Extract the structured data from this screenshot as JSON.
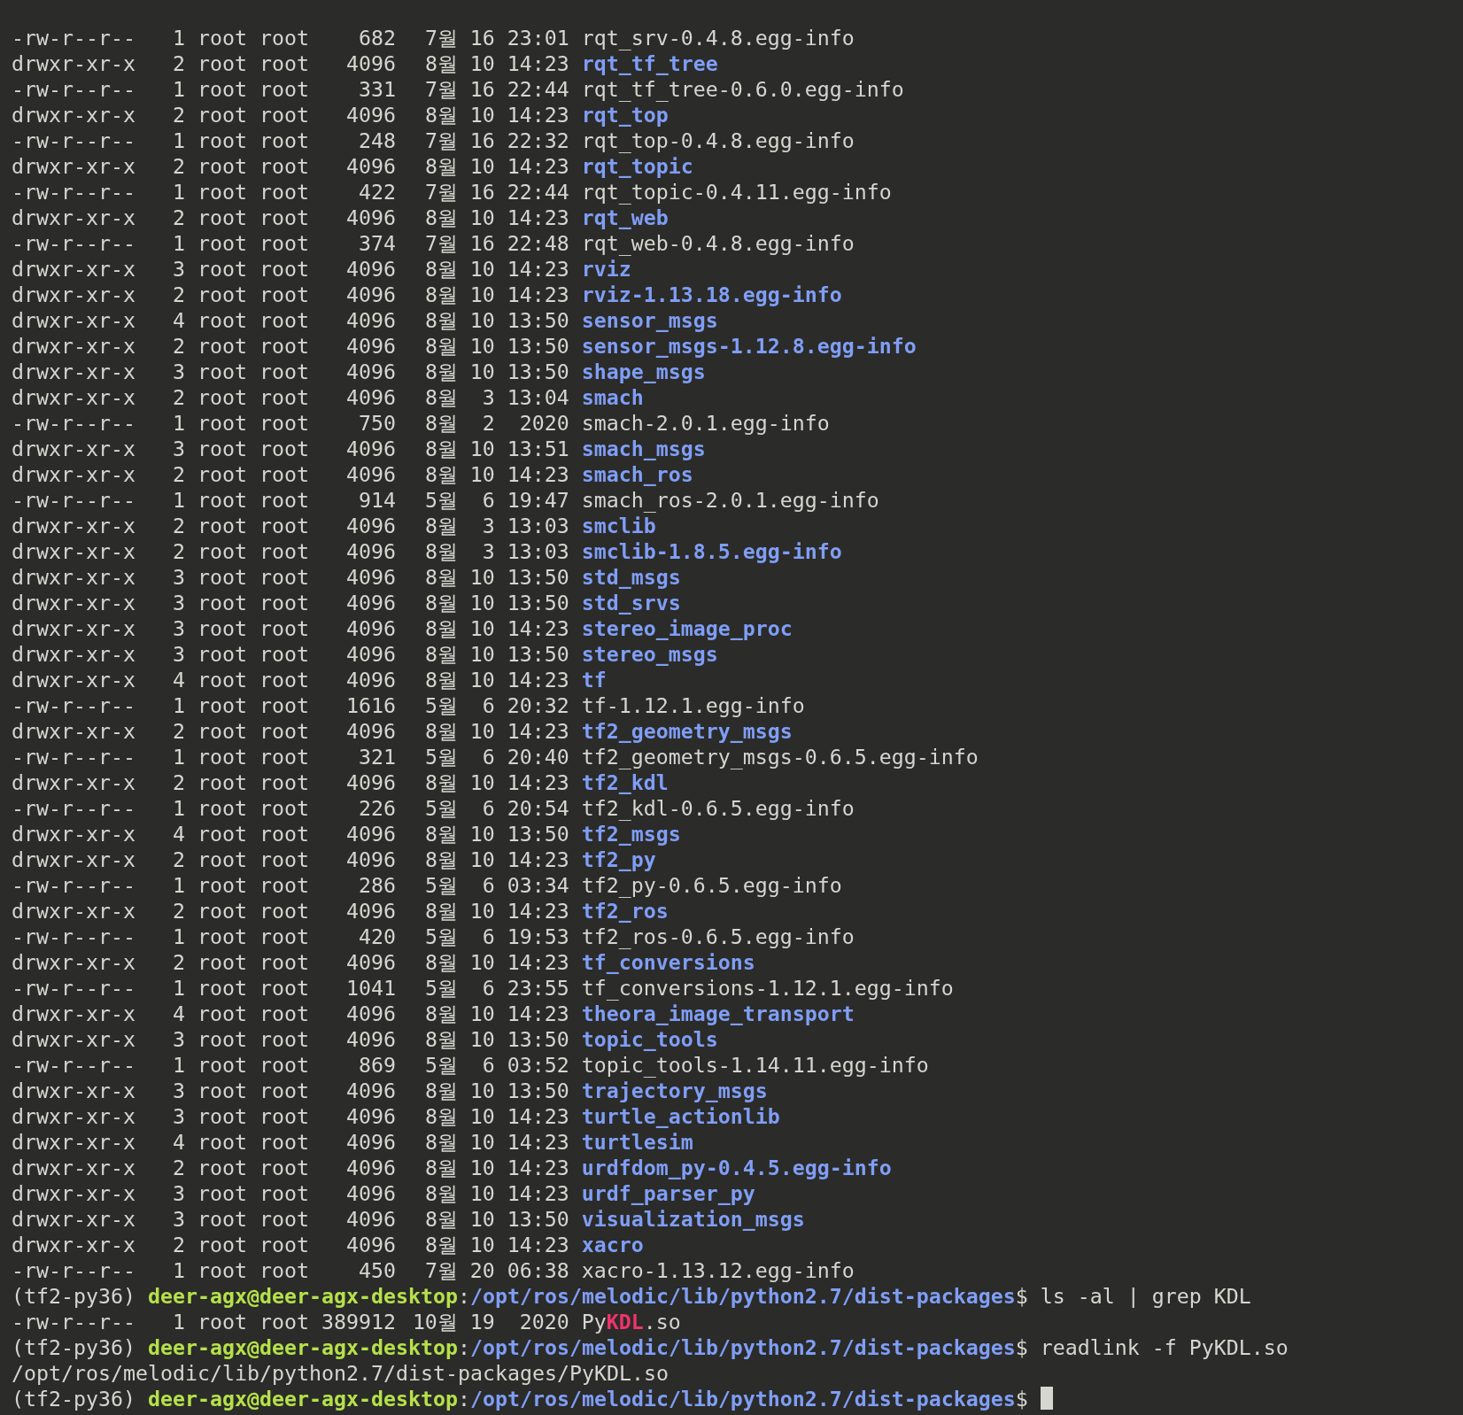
{
  "terminal": {
    "lines": [
      {
        "kind": "entry",
        "mode": "-rw-r--r--",
        "links": "1",
        "owner": "root",
        "group": "root",
        "size": "682",
        "month": "7월",
        "day": "16",
        "time": "23:01",
        "name": "rqt_srv-0.4.8.egg-info",
        "directory": false
      },
      {
        "kind": "entry",
        "mode": "drwxr-xr-x",
        "links": "2",
        "owner": "root",
        "group": "root",
        "size": "4096",
        "month": "8월",
        "day": "10",
        "time": "14:23",
        "name": "rqt_tf_tree",
        "directory": true
      },
      {
        "kind": "entry",
        "mode": "-rw-r--r--",
        "links": "1",
        "owner": "root",
        "group": "root",
        "size": "331",
        "month": "7월",
        "day": "16",
        "time": "22:44",
        "name": "rqt_tf_tree-0.6.0.egg-info",
        "directory": false
      },
      {
        "kind": "entry",
        "mode": "drwxr-xr-x",
        "links": "2",
        "owner": "root",
        "group": "root",
        "size": "4096",
        "month": "8월",
        "day": "10",
        "time": "14:23",
        "name": "rqt_top",
        "directory": true
      },
      {
        "kind": "entry",
        "mode": "-rw-r--r--",
        "links": "1",
        "owner": "root",
        "group": "root",
        "size": "248",
        "month": "7월",
        "day": "16",
        "time": "22:32",
        "name": "rqt_top-0.4.8.egg-info",
        "directory": false
      },
      {
        "kind": "entry",
        "mode": "drwxr-xr-x",
        "links": "2",
        "owner": "root",
        "group": "root",
        "size": "4096",
        "month": "8월",
        "day": "10",
        "time": "14:23",
        "name": "rqt_topic",
        "directory": true
      },
      {
        "kind": "entry",
        "mode": "-rw-r--r--",
        "links": "1",
        "owner": "root",
        "group": "root",
        "size": "422",
        "month": "7월",
        "day": "16",
        "time": "22:44",
        "name": "rqt_topic-0.4.11.egg-info",
        "directory": false
      },
      {
        "kind": "entry",
        "mode": "drwxr-xr-x",
        "links": "2",
        "owner": "root",
        "group": "root",
        "size": "4096",
        "month": "8월",
        "day": "10",
        "time": "14:23",
        "name": "rqt_web",
        "directory": true
      },
      {
        "kind": "entry",
        "mode": "-rw-r--r--",
        "links": "1",
        "owner": "root",
        "group": "root",
        "size": "374",
        "month": "7월",
        "day": "16",
        "time": "22:48",
        "name": "rqt_web-0.4.8.egg-info",
        "directory": false
      },
      {
        "kind": "entry",
        "mode": "drwxr-xr-x",
        "links": "3",
        "owner": "root",
        "group": "root",
        "size": "4096",
        "month": "8월",
        "day": "10",
        "time": "14:23",
        "name": "rviz",
        "directory": true
      },
      {
        "kind": "entry",
        "mode": "drwxr-xr-x",
        "links": "2",
        "owner": "root",
        "group": "root",
        "size": "4096",
        "month": "8월",
        "day": "10",
        "time": "14:23",
        "name": "rviz-1.13.18.egg-info",
        "directory": true
      },
      {
        "kind": "entry",
        "mode": "drwxr-xr-x",
        "links": "4",
        "owner": "root",
        "group": "root",
        "size": "4096",
        "month": "8월",
        "day": "10",
        "time": "13:50",
        "name": "sensor_msgs",
        "directory": true
      },
      {
        "kind": "entry",
        "mode": "drwxr-xr-x",
        "links": "2",
        "owner": "root",
        "group": "root",
        "size": "4096",
        "month": "8월",
        "day": "10",
        "time": "13:50",
        "name": "sensor_msgs-1.12.8.egg-info",
        "directory": true
      },
      {
        "kind": "entry",
        "mode": "drwxr-xr-x",
        "links": "3",
        "owner": "root",
        "group": "root",
        "size": "4096",
        "month": "8월",
        "day": "10",
        "time": "13:50",
        "name": "shape_msgs",
        "directory": true
      },
      {
        "kind": "entry",
        "mode": "drwxr-xr-x",
        "links": "2",
        "owner": "root",
        "group": "root",
        "size": "4096",
        "month": "8월",
        "day": "3",
        "time": "13:04",
        "name": "smach",
        "directory": true
      },
      {
        "kind": "entry",
        "mode": "-rw-r--r--",
        "links": "1",
        "owner": "root",
        "group": "root",
        "size": "750",
        "month": "8월",
        "day": "2",
        "time": "2020",
        "name": "smach-2.0.1.egg-info",
        "directory": false
      },
      {
        "kind": "entry",
        "mode": "drwxr-xr-x",
        "links": "3",
        "owner": "root",
        "group": "root",
        "size": "4096",
        "month": "8월",
        "day": "10",
        "time": "13:51",
        "name": "smach_msgs",
        "directory": true
      },
      {
        "kind": "entry",
        "mode": "drwxr-xr-x",
        "links": "2",
        "owner": "root",
        "group": "root",
        "size": "4096",
        "month": "8월",
        "day": "10",
        "time": "14:23",
        "name": "smach_ros",
        "directory": true
      },
      {
        "kind": "entry",
        "mode": "-rw-r--r--",
        "links": "1",
        "owner": "root",
        "group": "root",
        "size": "914",
        "month": "5월",
        "day": "6",
        "time": "19:47",
        "name": "smach_ros-2.0.1.egg-info",
        "directory": false
      },
      {
        "kind": "entry",
        "mode": "drwxr-xr-x",
        "links": "2",
        "owner": "root",
        "group": "root",
        "size": "4096",
        "month": "8월",
        "day": "3",
        "time": "13:03",
        "name": "smclib",
        "directory": true
      },
      {
        "kind": "entry",
        "mode": "drwxr-xr-x",
        "links": "2",
        "owner": "root",
        "group": "root",
        "size": "4096",
        "month": "8월",
        "day": "3",
        "time": "13:03",
        "name": "smclib-1.8.5.egg-info",
        "directory": true
      },
      {
        "kind": "entry",
        "mode": "drwxr-xr-x",
        "links": "3",
        "owner": "root",
        "group": "root",
        "size": "4096",
        "month": "8월",
        "day": "10",
        "time": "13:50",
        "name": "std_msgs",
        "directory": true
      },
      {
        "kind": "entry",
        "mode": "drwxr-xr-x",
        "links": "3",
        "owner": "root",
        "group": "root",
        "size": "4096",
        "month": "8월",
        "day": "10",
        "time": "13:50",
        "name": "std_srvs",
        "directory": true
      },
      {
        "kind": "entry",
        "mode": "drwxr-xr-x",
        "links": "3",
        "owner": "root",
        "group": "root",
        "size": "4096",
        "month": "8월",
        "day": "10",
        "time": "14:23",
        "name": "stereo_image_proc",
        "directory": true
      },
      {
        "kind": "entry",
        "mode": "drwxr-xr-x",
        "links": "3",
        "owner": "root",
        "group": "root",
        "size": "4096",
        "month": "8월",
        "day": "10",
        "time": "13:50",
        "name": "stereo_msgs",
        "directory": true
      },
      {
        "kind": "entry",
        "mode": "drwxr-xr-x",
        "links": "4",
        "owner": "root",
        "group": "root",
        "size": "4096",
        "month": "8월",
        "day": "10",
        "time": "14:23",
        "name": "tf",
        "directory": true
      },
      {
        "kind": "entry",
        "mode": "-rw-r--r--",
        "links": "1",
        "owner": "root",
        "group": "root",
        "size": "1616",
        "month": "5월",
        "day": "6",
        "time": "20:32",
        "name": "tf-1.12.1.egg-info",
        "directory": false
      },
      {
        "kind": "entry",
        "mode": "drwxr-xr-x",
        "links": "2",
        "owner": "root",
        "group": "root",
        "size": "4096",
        "month": "8월",
        "day": "10",
        "time": "14:23",
        "name": "tf2_geometry_msgs",
        "directory": true
      },
      {
        "kind": "entry",
        "mode": "-rw-r--r--",
        "links": "1",
        "owner": "root",
        "group": "root",
        "size": "321",
        "month": "5월",
        "day": "6",
        "time": "20:40",
        "name": "tf2_geometry_msgs-0.6.5.egg-info",
        "directory": false
      },
      {
        "kind": "entry",
        "mode": "drwxr-xr-x",
        "links": "2",
        "owner": "root",
        "group": "root",
        "size": "4096",
        "month": "8월",
        "day": "10",
        "time": "14:23",
        "name": "tf2_kdl",
        "directory": true
      },
      {
        "kind": "entry",
        "mode": "-rw-r--r--",
        "links": "1",
        "owner": "root",
        "group": "root",
        "size": "226",
        "month": "5월",
        "day": "6",
        "time": "20:54",
        "name": "tf2_kdl-0.6.5.egg-info",
        "directory": false
      },
      {
        "kind": "entry",
        "mode": "drwxr-xr-x",
        "links": "4",
        "owner": "root",
        "group": "root",
        "size": "4096",
        "month": "8월",
        "day": "10",
        "time": "13:50",
        "name": "tf2_msgs",
        "directory": true
      },
      {
        "kind": "entry",
        "mode": "drwxr-xr-x",
        "links": "2",
        "owner": "root",
        "group": "root",
        "size": "4096",
        "month": "8월",
        "day": "10",
        "time": "14:23",
        "name": "tf2_py",
        "directory": true
      },
      {
        "kind": "entry",
        "mode": "-rw-r--r--",
        "links": "1",
        "owner": "root",
        "group": "root",
        "size": "286",
        "month": "5월",
        "day": "6",
        "time": "03:34",
        "name": "tf2_py-0.6.5.egg-info",
        "directory": false
      },
      {
        "kind": "entry",
        "mode": "drwxr-xr-x",
        "links": "2",
        "owner": "root",
        "group": "root",
        "size": "4096",
        "month": "8월",
        "day": "10",
        "time": "14:23",
        "name": "tf2_ros",
        "directory": true
      },
      {
        "kind": "entry",
        "mode": "-rw-r--r--",
        "links": "1",
        "owner": "root",
        "group": "root",
        "size": "420",
        "month": "5월",
        "day": "6",
        "time": "19:53",
        "name": "tf2_ros-0.6.5.egg-info",
        "directory": false
      },
      {
        "kind": "entry",
        "mode": "drwxr-xr-x",
        "links": "2",
        "owner": "root",
        "group": "root",
        "size": "4096",
        "month": "8월",
        "day": "10",
        "time": "14:23",
        "name": "tf_conversions",
        "directory": true
      },
      {
        "kind": "entry",
        "mode": "-rw-r--r--",
        "links": "1",
        "owner": "root",
        "group": "root",
        "size": "1041",
        "month": "5월",
        "day": "6",
        "time": "23:55",
        "name": "tf_conversions-1.12.1.egg-info",
        "directory": false
      },
      {
        "kind": "entry",
        "mode": "drwxr-xr-x",
        "links": "4",
        "owner": "root",
        "group": "root",
        "size": "4096",
        "month": "8월",
        "day": "10",
        "time": "14:23",
        "name": "theora_image_transport",
        "directory": true
      },
      {
        "kind": "entry",
        "mode": "drwxr-xr-x",
        "links": "3",
        "owner": "root",
        "group": "root",
        "size": "4096",
        "month": "8월",
        "day": "10",
        "time": "13:50",
        "name": "topic_tools",
        "directory": true
      },
      {
        "kind": "entry",
        "mode": "-rw-r--r--",
        "links": "1",
        "owner": "root",
        "group": "root",
        "size": "869",
        "month": "5월",
        "day": "6",
        "time": "03:52",
        "name": "topic_tools-1.14.11.egg-info",
        "directory": false
      },
      {
        "kind": "entry",
        "mode": "drwxr-xr-x",
        "links": "3",
        "owner": "root",
        "group": "root",
        "size": "4096",
        "month": "8월",
        "day": "10",
        "time": "13:50",
        "name": "trajectory_msgs",
        "directory": true
      },
      {
        "kind": "entry",
        "mode": "drwxr-xr-x",
        "links": "3",
        "owner": "root",
        "group": "root",
        "size": "4096",
        "month": "8월",
        "day": "10",
        "time": "14:23",
        "name": "turtle_actionlib",
        "directory": true
      },
      {
        "kind": "entry",
        "mode": "drwxr-xr-x",
        "links": "4",
        "owner": "root",
        "group": "root",
        "size": "4096",
        "month": "8월",
        "day": "10",
        "time": "14:23",
        "name": "turtlesim",
        "directory": true
      },
      {
        "kind": "entry",
        "mode": "drwxr-xr-x",
        "links": "2",
        "owner": "root",
        "group": "root",
        "size": "4096",
        "month": "8월",
        "day": "10",
        "time": "14:23",
        "name": "urdfdom_py-0.4.5.egg-info",
        "directory": true
      },
      {
        "kind": "entry",
        "mode": "drwxr-xr-x",
        "links": "3",
        "owner": "root",
        "group": "root",
        "size": "4096",
        "month": "8월",
        "day": "10",
        "time": "14:23",
        "name": "urdf_parser_py",
        "directory": true
      },
      {
        "kind": "entry",
        "mode": "drwxr-xr-x",
        "links": "3",
        "owner": "root",
        "group": "root",
        "size": "4096",
        "month": "8월",
        "day": "10",
        "time": "13:50",
        "name": "visualization_msgs",
        "directory": true
      },
      {
        "kind": "entry",
        "mode": "drwxr-xr-x",
        "links": "2",
        "owner": "root",
        "group": "root",
        "size": "4096",
        "month": "8월",
        "day": "10",
        "time": "14:23",
        "name": "xacro",
        "directory": true
      },
      {
        "kind": "entry",
        "mode": "-rw-r--r--",
        "links": "1",
        "owner": "root",
        "group": "root",
        "size": "450",
        "month": "7월",
        "day": "20",
        "time": "06:38",
        "name": "xacro-1.13.12.egg-info",
        "directory": false
      },
      {
        "kind": "prompt",
        "env": "(tf2-py36)",
        "user": "deer-agx@deer-agx-desktop",
        "separator": ":",
        "path": "/opt/ros/melodic/lib/python2.7/dist-packages",
        "symbol": "$",
        "command": "ls -al | grep KDL",
        "cursor": false
      },
      {
        "kind": "entry",
        "mode": "-rw-r--r--",
        "links": "1",
        "owner": "root",
        "group": "root",
        "size": "389912",
        "month": "10월",
        "day": "19",
        "time": "2020",
        "name_parts": [
          {
            "text": "Py",
            "match": false
          },
          {
            "text": "KDL",
            "match": true
          },
          {
            "text": ".so",
            "match": false
          }
        ],
        "directory": false
      },
      {
        "kind": "prompt",
        "env": "(tf2-py36)",
        "user": "deer-agx@deer-agx-desktop",
        "separator": ":",
        "path": "/opt/ros/melodic/lib/python2.7/dist-packages",
        "symbol": "$",
        "command": "readlink -f PyKDL.so",
        "cursor": false
      },
      {
        "kind": "output",
        "text": "/opt/ros/melodic/lib/python2.7/dist-packages/PyKDL.so"
      },
      {
        "kind": "prompt",
        "env": "(tf2-py36)",
        "user": "deer-agx@deer-agx-desktop",
        "separator": ":",
        "path": "/opt/ros/melodic/lib/python2.7/dist-packages",
        "symbol": "$",
        "cursor": true
      }
    ]
  }
}
